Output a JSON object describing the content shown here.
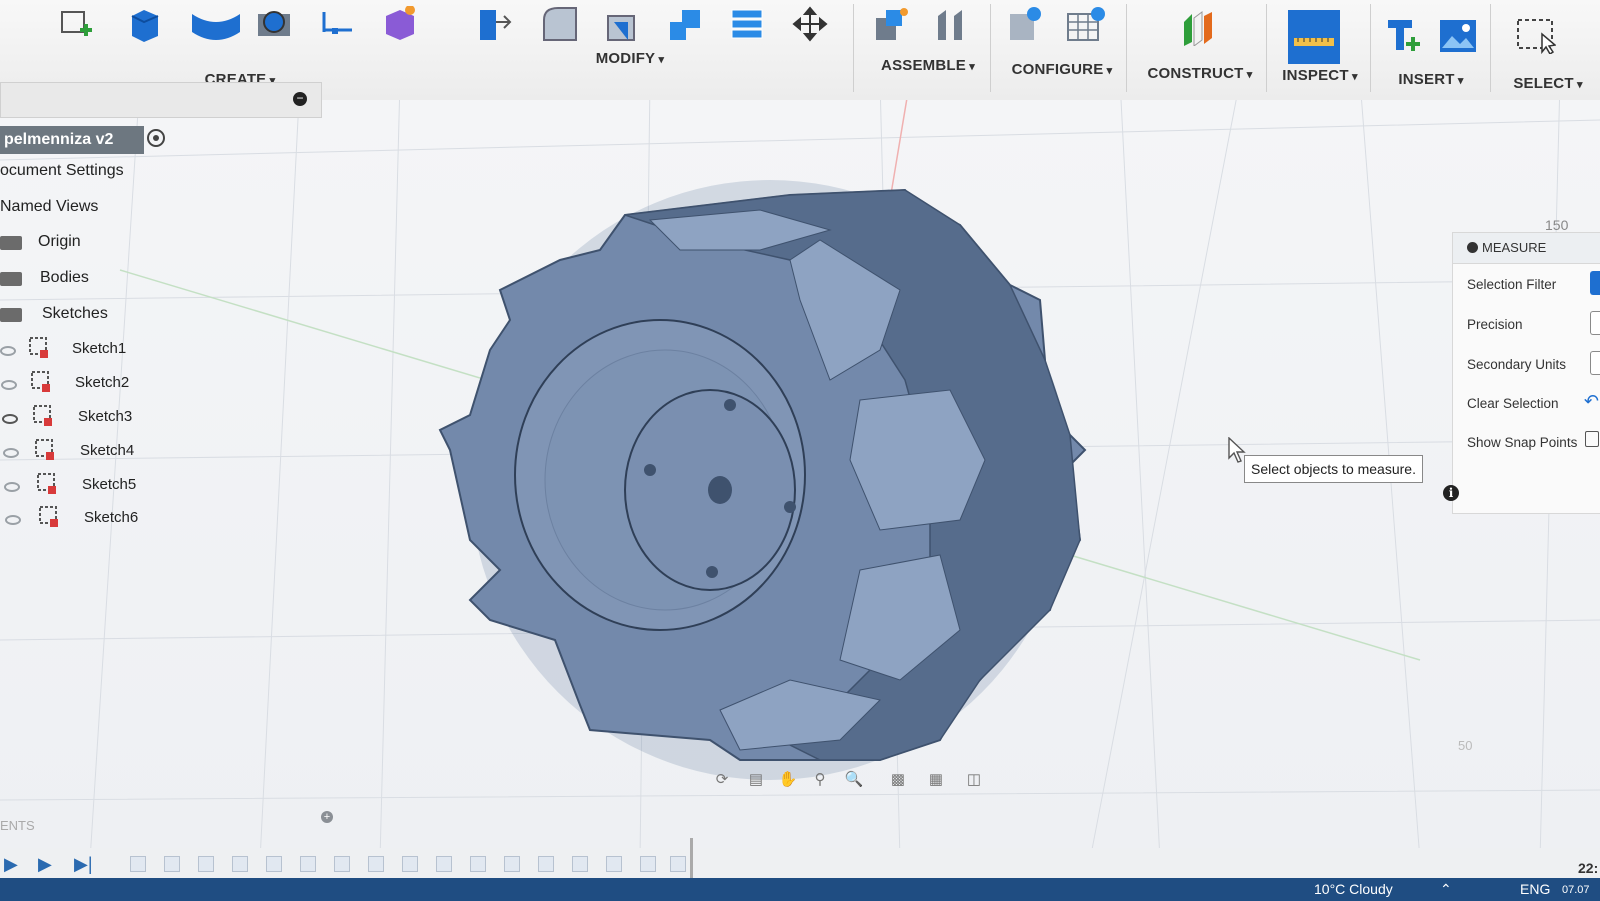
{
  "toolbar": {
    "groups": [
      {
        "label": "CREATE"
      },
      {
        "label": "MODIFY"
      },
      {
        "label": "ASSEMBLE"
      },
      {
        "label": "CONFIGURE"
      },
      {
        "label": "CONSTRUCT"
      },
      {
        "label": "INSPECT"
      },
      {
        "label": "INSERT"
      },
      {
        "label": "SELECT"
      }
    ]
  },
  "browser": {
    "document_title": "pelmenniza v2",
    "items": [
      {
        "label": "ocument Settings"
      },
      {
        "label": "Named Views"
      },
      {
        "label": "Origin"
      },
      {
        "label": "Bodies"
      },
      {
        "label": "Sketches"
      }
    ],
    "sketches": [
      "Sketch1",
      "Sketch2",
      "Sketch3",
      "Sketch4",
      "Sketch5",
      "Sketch6"
    ]
  },
  "viewport": {
    "grid_label_top": "150",
    "grid_label_bottom": "50"
  },
  "measure_panel": {
    "title": "MEASURE",
    "rows": [
      "Selection Filter",
      "Precision",
      "Secondary Units",
      "Clear Selection",
      "Show Snap Points"
    ]
  },
  "tooltip": {
    "text": "Select objects to measure."
  },
  "comments": {
    "label": "ENTS"
  },
  "taskbar": {
    "weather": "10°C Cloudy",
    "language": "ENG",
    "time": "22:",
    "date": "07.07"
  },
  "colors": {
    "part": "#6f86a8",
    "toolbar_blue": "#1e6fd0",
    "construct_green": "#2e9e3a",
    "construct_orange": "#e36a1c"
  }
}
